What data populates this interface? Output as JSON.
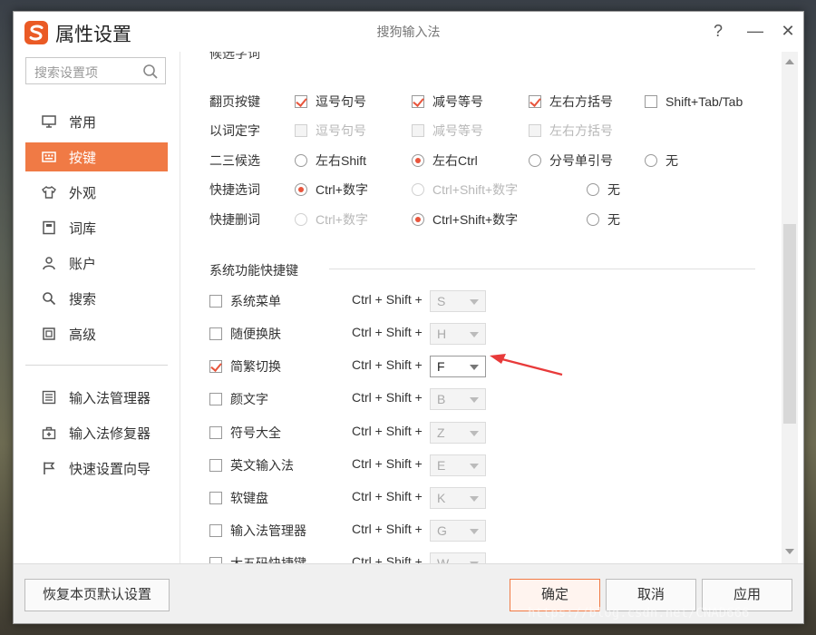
{
  "window": {
    "title": "属性设置",
    "center_title": "搜狗输入法"
  },
  "titlebar": {
    "help": "?",
    "minimize": "—",
    "close": "✕"
  },
  "search": {
    "placeholder": "搜索设置项"
  },
  "sidebar": {
    "items": [
      {
        "label": "常用",
        "icon": "monitor-icon"
      },
      {
        "label": "按键",
        "icon": "keyboard-icon",
        "active": true
      },
      {
        "label": "外观",
        "icon": "shirt-icon"
      },
      {
        "label": "词库",
        "icon": "book-icon"
      },
      {
        "label": "账户",
        "icon": "user-icon"
      },
      {
        "label": "搜索",
        "icon": "search-icon"
      },
      {
        "label": "高级",
        "icon": "advanced-icon"
      }
    ],
    "tools": [
      {
        "label": "输入法管理器",
        "icon": "list-icon"
      },
      {
        "label": "输入法修复器",
        "icon": "toolbox-icon"
      },
      {
        "label": "快速设置向导",
        "icon": "flag-icon"
      }
    ]
  },
  "candidates": {
    "heading_partial": "候选字词",
    "rows": [
      {
        "label": "翻页按键",
        "options": [
          {
            "text": "逗号句号",
            "type": "checkbox",
            "checked": true
          },
          {
            "text": "减号等号",
            "type": "checkbox",
            "checked": true
          },
          {
            "text": "左右方括号",
            "type": "checkbox",
            "checked": true
          },
          {
            "text": "Shift+Tab/Tab",
            "type": "checkbox",
            "checked": false
          }
        ]
      },
      {
        "label": "以词定字",
        "options": [
          {
            "text": "逗号句号",
            "type": "checkbox",
            "disabled": true
          },
          {
            "text": "减号等号",
            "type": "checkbox",
            "disabled": true
          },
          {
            "text": "左右方括号",
            "type": "checkbox",
            "disabled": true
          }
        ]
      },
      {
        "label": "二三候选",
        "options": [
          {
            "text": "左右Shift",
            "type": "radio"
          },
          {
            "text": "左右Ctrl",
            "type": "radio",
            "checked": true
          },
          {
            "text": "分号单引号",
            "type": "radio"
          },
          {
            "text": "无",
            "type": "radio"
          }
        ]
      },
      {
        "label": "快捷选词",
        "options": [
          {
            "text": "Ctrl+数字",
            "type": "radio",
            "checked": true
          },
          {
            "text": "Ctrl+Shift+数字",
            "type": "radio",
            "disabled": true
          },
          {
            "text": "无",
            "type": "radio"
          }
        ]
      },
      {
        "label": "快捷删词",
        "options": [
          {
            "text": "Ctrl+数字",
            "type": "radio",
            "disabled": true
          },
          {
            "text": "Ctrl+Shift+数字",
            "type": "radio",
            "checked": true
          },
          {
            "text": "无",
            "type": "radio"
          }
        ]
      }
    ]
  },
  "hotkeys": {
    "section_title": "系统功能快捷键",
    "prefix": "Ctrl + Shift +",
    "rows": [
      {
        "label": "系统菜单",
        "key": "S",
        "checked": false
      },
      {
        "label": "随便换肤",
        "key": "H",
        "checked": false
      },
      {
        "label": "简繁切换",
        "key": "F",
        "checked": true
      },
      {
        "label": "颜文字",
        "key": "B",
        "checked": false
      },
      {
        "label": "符号大全",
        "key": "Z",
        "checked": false
      },
      {
        "label": "英文输入法",
        "key": "E",
        "checked": false
      },
      {
        "label": "软键盘",
        "key": "K",
        "checked": false
      },
      {
        "label": "输入法管理器",
        "key": "G",
        "checked": false
      },
      {
        "label": "大五码快捷键",
        "key": "W",
        "checked": false
      }
    ]
  },
  "footer": {
    "reset": "恢复本页默认设置",
    "ok": "确定",
    "cancel": "取消",
    "apply": "应用"
  },
  "watermark": "https://blog.csdn.net/CNAD666",
  "colors": {
    "accent": "#f07a45",
    "check": "#e8553c",
    "arrow": "#e83a3a"
  }
}
